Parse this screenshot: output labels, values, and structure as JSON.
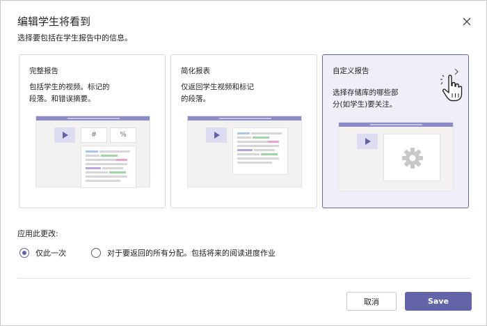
{
  "dialog": {
    "title": "编辑学生将看到",
    "subtitle": "选择要包括在学生报告中的信息。",
    "close_icon": "close-icon"
  },
  "cards": [
    {
      "title": "完整报告",
      "desc_line1": "包括学生的视频。标记的",
      "desc_line2": "段落。和错误摘要。",
      "selected": false
    },
    {
      "title": "简化报表",
      "desc_line1": "仅返回学生视频和标记",
      "desc_line2": "的段落。",
      "selected": false
    },
    {
      "title": "自定义报告",
      "desc_line1": "选择存储库的哪些部",
      "desc_line2": "分(如学生)要关注。",
      "selected": true
    }
  ],
  "illustration": {
    "tile_hash": "#",
    "tile_percent": "%"
  },
  "apply": {
    "label": "应用此更改:",
    "options": [
      {
        "label": "仅此一次",
        "selected": true
      },
      {
        "label": "对于要返回的所有分配。包括将来的阅读进度作业",
        "selected": false
      }
    ]
  },
  "buttons": {
    "cancel_label": "取消",
    "save_label": "Save"
  },
  "colors": {
    "accent": "#6264a7",
    "selected_card_bg": "#efeffa"
  }
}
